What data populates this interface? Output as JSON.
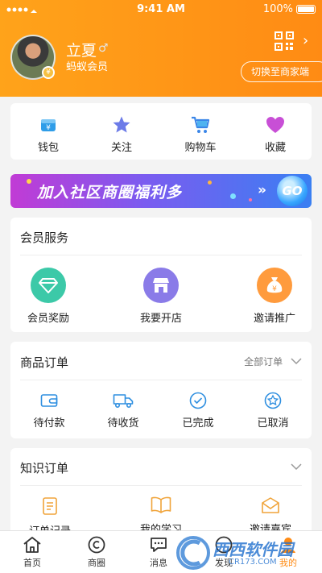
{
  "status": {
    "time": "9:41 AM",
    "battery": "100%"
  },
  "profile": {
    "name": "立夏",
    "gender_symbol": "♂",
    "level": "蚂蚁会员",
    "switch_label": "切换至商家端"
  },
  "quick_actions": [
    {
      "label": "钱包",
      "icon": "wallet-icon"
    },
    {
      "label": "关注",
      "icon": "star-icon"
    },
    {
      "label": "购物车",
      "icon": "cart-icon"
    },
    {
      "label": "收藏",
      "icon": "heart-icon"
    }
  ],
  "banner": {
    "text": "加入社区商圈福利多",
    "arrows": "»",
    "go": "GO"
  },
  "member_services": {
    "title": "会员服务",
    "items": [
      {
        "label": "会员奖励",
        "icon": "diamond-icon"
      },
      {
        "label": "我要开店",
        "icon": "shop-icon"
      },
      {
        "label": "邀请推广",
        "icon": "money-bag-icon"
      }
    ]
  },
  "product_orders": {
    "title": "商品订单",
    "all_label": "全部订单",
    "items": [
      {
        "label": "待付款",
        "icon": "wallet-outline-icon"
      },
      {
        "label": "待收货",
        "icon": "truck-icon"
      },
      {
        "label": "已完成",
        "icon": "check-circle-icon"
      },
      {
        "label": "已取消",
        "icon": "cancel-circle-icon"
      }
    ]
  },
  "knowledge_orders": {
    "title": "知识订单",
    "items": [
      {
        "label": "订单记录",
        "icon": "document-icon"
      },
      {
        "label": "我的学习",
        "icon": "book-icon"
      },
      {
        "label": "邀请嘉宾",
        "icon": "envelope-icon"
      }
    ]
  },
  "tabbar": [
    {
      "label": "首页",
      "icon": "home-icon",
      "active": false
    },
    {
      "label": "商圈",
      "icon": "circle-icon",
      "active": false
    },
    {
      "label": "消息",
      "icon": "message-icon",
      "active": false
    },
    {
      "label": "发现",
      "icon": "discover-icon",
      "active": false
    },
    {
      "label": "我的",
      "icon": "user-icon",
      "active": true
    }
  ],
  "watermark": {
    "text": "西西软件园",
    "url": "CR173.COM"
  },
  "colors": {
    "header_start": "#ffa31a",
    "header_end": "#ff8b14",
    "accent": "#ff8b14"
  }
}
